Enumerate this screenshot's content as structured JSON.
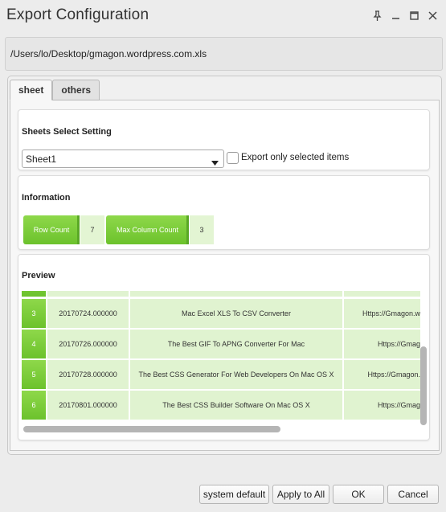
{
  "window": {
    "title": "Export Configuration",
    "controls": [
      "pin-icon",
      "minimize-icon",
      "maximize-icon",
      "close-icon"
    ]
  },
  "file_path": "/Users/lo/Desktop/gmagon.wordpress.com.xls",
  "tabs": [
    {
      "label": "sheet",
      "active": true
    },
    {
      "label": "others",
      "active": false
    }
  ],
  "sheets_select": {
    "title": "Sheets Select Setting",
    "selected": "Sheet1",
    "checkbox_label": "Export only selected items",
    "checked": false
  },
  "information": {
    "title": "Information",
    "row_count_label": "Row Count",
    "row_count": "7",
    "col_count_label": "Max Column Count",
    "col_count": "3"
  },
  "preview": {
    "title": "Preview",
    "rows": [
      {
        "index": "3",
        "date": "20170724.000000",
        "title": "Mac Excel XLS To CSV Converter",
        "url": "Https://Gmagon.w"
      },
      {
        "index": "4",
        "date": "20170726.000000",
        "title": "The Best GIF To APNG Converter For Mac",
        "url": "Https://Gmag"
      },
      {
        "index": "5",
        "date": "20170728.000000",
        "title": "The Best CSS Generator For Web Developers On Mac OS X",
        "url": "Https://Gmagon."
      },
      {
        "index": "6",
        "date": "20170801.000000",
        "title": "The Best CSS Builder Software On Mac OS X",
        "url": "Https://Gmag"
      }
    ]
  },
  "buttons": {
    "system_default": "system default",
    "apply_to_all": "Apply to All",
    "ok": "OK",
    "cancel": "Cancel"
  },
  "colors": {
    "accent_green": "#7ccd3a",
    "cell_green": "#e0f3d0"
  }
}
